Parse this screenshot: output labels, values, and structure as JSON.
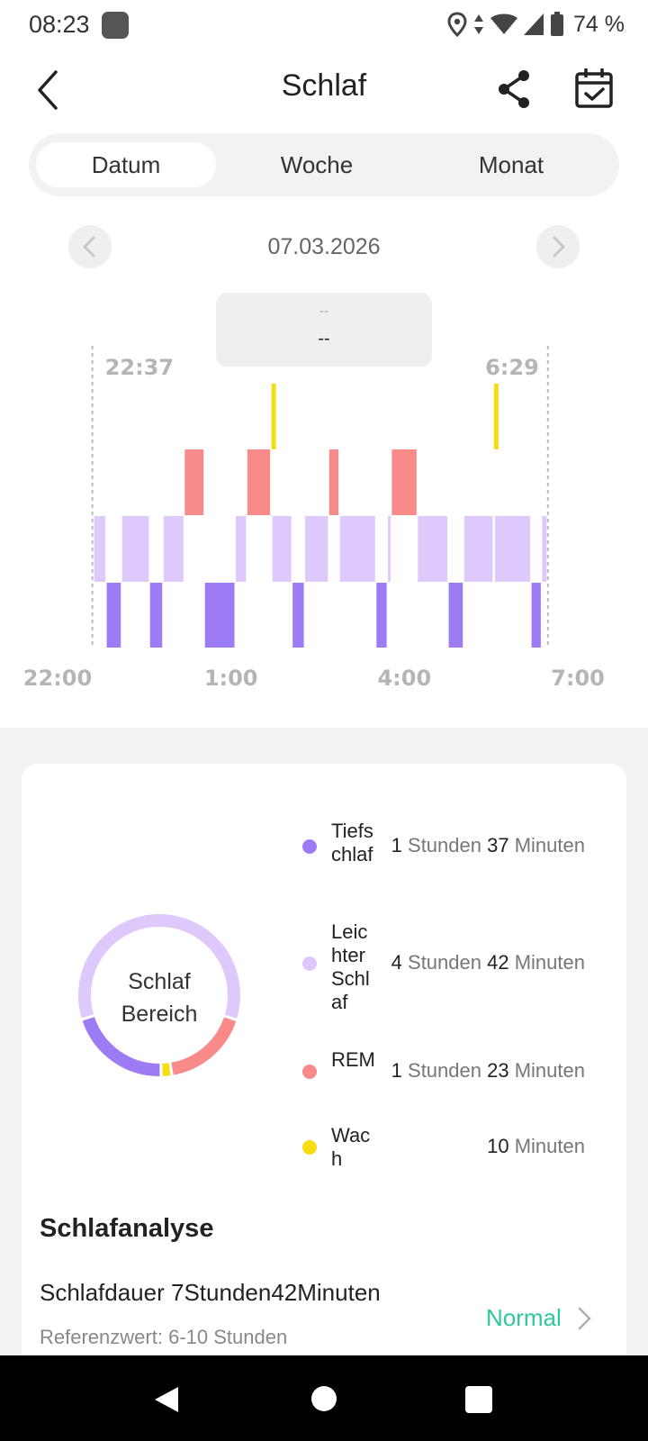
{
  "status": {
    "time": "08:23",
    "battery": "74 %",
    "icons": [
      "location-icon",
      "data-arrows-icon",
      "wifi-icon",
      "signal-icon",
      "battery-icon"
    ]
  },
  "header": {
    "title": "Schlaf"
  },
  "tabs": [
    {
      "label": "Datum",
      "active": true
    },
    {
      "label": "Woche",
      "active": false
    },
    {
      "label": "Monat",
      "active": false
    }
  ],
  "date": "07.03.2026",
  "tooltip": {
    "line1": "--",
    "line2": "--"
  },
  "colors": {
    "deep": "#9d7bf5",
    "light": "#ddc9fb",
    "rem": "#f88a8a",
    "awake": "#f5dd10",
    "accent": "#2ec99a"
  },
  "chart_data": {
    "type": "timeline",
    "start_label": "22:37",
    "end_label": "6:29",
    "x_ticks": [
      "22:00",
      "1:00",
      "4:00",
      "7:00"
    ],
    "stages": [
      "awake",
      "rem",
      "light",
      "deep"
    ],
    "segments": [
      {
        "stage": "light",
        "start": "22:38",
        "end": "22:51"
      },
      {
        "stage": "deep",
        "start": "22:51",
        "end": "23:07"
      },
      {
        "stage": "light",
        "start": "23:07",
        "end": "23:36"
      },
      {
        "stage": "deep",
        "start": "23:36",
        "end": "23:50"
      },
      {
        "stage": "light",
        "start": "23:50",
        "end": "00:12"
      },
      {
        "stage": "rem",
        "start": "00:12",
        "end": "00:33"
      },
      {
        "stage": "deep",
        "start": "00:33",
        "end": "01:05"
      },
      {
        "stage": "light",
        "start": "01:05",
        "end": "01:17"
      },
      {
        "stage": "rem",
        "start": "01:17",
        "end": "01:42"
      },
      {
        "stage": "awake",
        "start": "01:42",
        "end": "01:43"
      },
      {
        "stage": "light",
        "start": "01:43",
        "end": "02:04"
      },
      {
        "stage": "deep",
        "start": "02:04",
        "end": "02:17"
      },
      {
        "stage": "light",
        "start": "02:17",
        "end": "02:42"
      },
      {
        "stage": "rem",
        "start": "02:42",
        "end": "02:53"
      },
      {
        "stage": "light",
        "start": "02:53",
        "end": "03:31"
      },
      {
        "stage": "deep",
        "start": "03:31",
        "end": "03:43"
      },
      {
        "stage": "light",
        "start": "03:43",
        "end": "03:47"
      },
      {
        "stage": "rem",
        "start": "03:47",
        "end": "04:14"
      },
      {
        "stage": "light",
        "start": "04:14",
        "end": "04:46"
      },
      {
        "stage": "deep",
        "start": "04:46",
        "end": "05:02"
      },
      {
        "stage": "light",
        "start": "05:02",
        "end": "05:33"
      },
      {
        "stage": "awake",
        "start": "05:33",
        "end": "05:34"
      },
      {
        "stage": "light",
        "start": "05:34",
        "end": "06:12"
      },
      {
        "stage": "deep",
        "start": "06:12",
        "end": "06:23"
      },
      {
        "stage": "light",
        "start": "06:23",
        "end": "06:29"
      }
    ]
  },
  "summary": {
    "donut_label": "Schlaf Bereich",
    "slices": [
      {
        "stage": "deep",
        "minutes": 97
      },
      {
        "stage": "light",
        "minutes": 282
      },
      {
        "stage": "rem",
        "minutes": 83
      },
      {
        "stage": "awake",
        "minutes": 10
      }
    ],
    "legend": [
      {
        "name": "Tiefschlaf",
        "hours": "1",
        "h_unit": "Stunden",
        "mins": "37",
        "m_unit": "Minuten"
      },
      {
        "name": "Leichter Schlaf",
        "hours": "4",
        "h_unit": "Stunden",
        "mins": "42",
        "m_unit": "Minuten"
      },
      {
        "name": "REM",
        "hours": "1",
        "h_unit": "Stunden",
        "mins": "23",
        "m_unit": "Minuten"
      },
      {
        "name": "Wach",
        "hours": "",
        "h_unit": "",
        "mins": "10",
        "m_unit": "Minuten"
      }
    ]
  },
  "analysis": {
    "title": "Schlafanalyse",
    "duration_label": "Schlafdauer",
    "duration_value": "7Stunden42Minuten",
    "reference_label": "Referenzwert:",
    "reference_value": "6-10 Stunden",
    "status": "Normal"
  }
}
